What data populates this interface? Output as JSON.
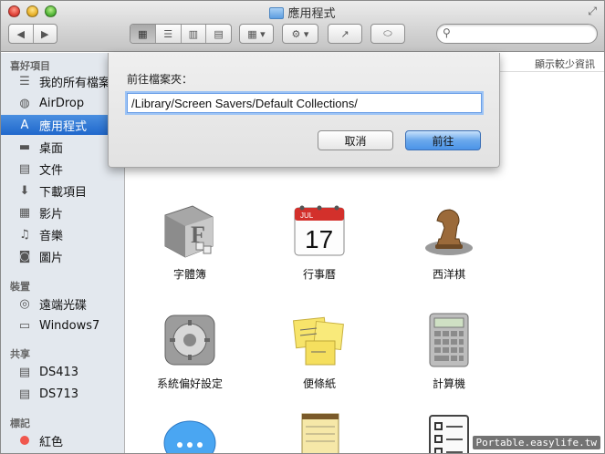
{
  "window": {
    "title": "應用程式"
  },
  "toolbar": {
    "back_glyph": "◀",
    "forward_glyph": "▶",
    "view_icons": [
      "▦",
      "☰",
      "▥",
      "▤"
    ],
    "arrange_glyph": "▦ ▾",
    "action_glyph": "⚙ ▾",
    "share_glyph": "↗",
    "tag_glyph": "⬭",
    "search_placeholder": ""
  },
  "sidebar": {
    "sections": [
      {
        "title": "喜好項目",
        "items": [
          {
            "label": "我的所有檔案",
            "icon": "all-files-icon",
            "glyph": "☰"
          },
          {
            "label": "AirDrop",
            "icon": "airdrop-icon",
            "glyph": "◍"
          },
          {
            "label": "應用程式",
            "icon": "applications-icon",
            "glyph": "A",
            "selected": true
          },
          {
            "label": "桌面",
            "icon": "desktop-icon",
            "glyph": "▬"
          },
          {
            "label": "文件",
            "icon": "documents-icon",
            "glyph": "▤"
          },
          {
            "label": "下載項目",
            "icon": "downloads-icon",
            "glyph": "⬇"
          },
          {
            "label": "影片",
            "icon": "movies-icon",
            "glyph": "▦"
          },
          {
            "label": "音樂",
            "icon": "music-icon",
            "glyph": "♫"
          },
          {
            "label": "圖片",
            "icon": "pictures-icon",
            "glyph": "◙"
          }
        ]
      },
      {
        "title": "裝置",
        "items": [
          {
            "label": "遠端光碟",
            "icon": "remote-disc-icon",
            "glyph": "◎"
          },
          {
            "label": "Windows7",
            "icon": "drive-icon",
            "glyph": "▭"
          }
        ]
      },
      {
        "title": "共享",
        "items": [
          {
            "label": "DS413",
            "icon": "server-icon",
            "glyph": "▤"
          },
          {
            "label": "DS713",
            "icon": "server-icon",
            "glyph": "▤"
          }
        ]
      },
      {
        "title": "標記",
        "items": [
          {
            "label": "紅色",
            "icon": "red-tag-icon",
            "glyph": ""
          }
        ]
      }
    ]
  },
  "content": {
    "show_less": "顯示較少資訊",
    "apps": [
      {
        "label": "字體簿",
        "icon": "font-book-icon"
      },
      {
        "label": "行事曆",
        "icon": "calendar-icon",
        "month": "JUL",
        "day": "17"
      },
      {
        "label": "西洋棋",
        "icon": "chess-icon"
      },
      {
        "label": "系統偏好設定",
        "icon": "system-preferences-icon"
      },
      {
        "label": "便條紙",
        "icon": "stickies-icon"
      },
      {
        "label": "計算機",
        "icon": "calculator-icon"
      }
    ]
  },
  "dialog": {
    "prompt": "前往檔案夾：",
    "path_value": "/Library/Screen Savers/Default Collections/",
    "cancel_label": "取消",
    "go_label": "前往"
  },
  "watermark": {
    "text": "Portable.easylife.tw"
  },
  "colors": {
    "selection": "#2f78d6",
    "primary_button": "#4b94e8",
    "red_tag": "#f0574e"
  }
}
